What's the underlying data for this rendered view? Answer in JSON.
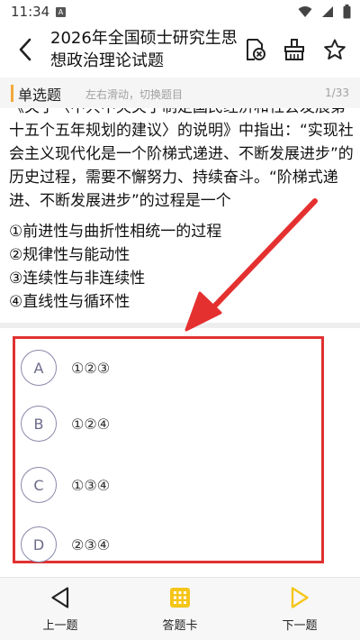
{
  "status_bar": {
    "time": "11:34",
    "badge": "A"
  },
  "header": {
    "title": "2026年全国硕士研究生思想政治理论试题"
  },
  "question_type": {
    "label": "单选题",
    "hint": "左右滑动，切换题目",
    "counter": "1/33"
  },
  "question": {
    "text": "《关于〈中共中央关于制定国民经济和社会发展第十五个五年规划的建议〉的说明》中指出：“实现社会主义现代化是一个阶梯式递进、不断发展进步”的历史过程，需要不懈努力、持续奋斗。“阶梯式递进、不断发展进步”的过程是一个",
    "statements": [
      "①前进性与曲折性相统一的过程",
      "②规律性与能动性",
      "③连续性与非连续性",
      "④直线性与循环性"
    ]
  },
  "options": [
    {
      "letter": "A",
      "text": "①②③"
    },
    {
      "letter": "B",
      "text": "①②④"
    },
    {
      "letter": "C",
      "text": "①③④"
    },
    {
      "letter": "D",
      "text": "②③④"
    }
  ],
  "bottom_nav": {
    "prev": "上一题",
    "card": "答题卡",
    "next": "下一题"
  },
  "colors": {
    "accent": "#f2a93b",
    "highlight": "#e03131",
    "nav_icon": "#f5c518"
  }
}
